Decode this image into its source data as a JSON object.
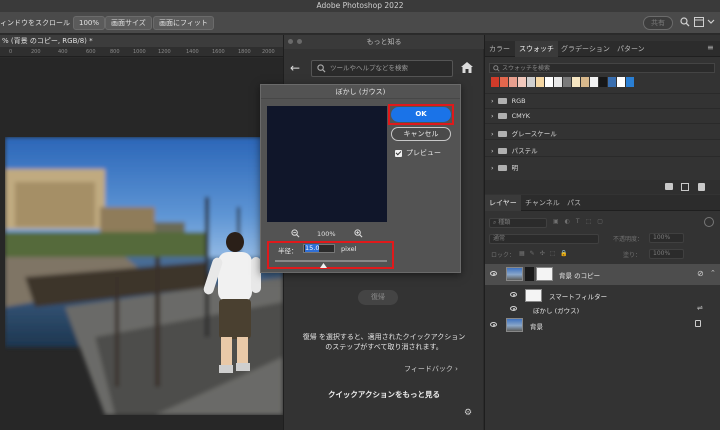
{
  "window": {
    "title": "Adobe Photoshop 2022"
  },
  "options_bar": {
    "scroll_all_label": "ィンドウをスクロール",
    "zoom_100_label": "100%",
    "screen_size_label": "画面サイズ",
    "fit_screen_label": "画面にフィット",
    "share_label": "共有"
  },
  "document": {
    "tab_title": "% (背景 のコピー, RGB/8) *",
    "ruler_ticks": [
      "0",
      "200",
      "400",
      "600",
      "800",
      "1000",
      "1200",
      "1400",
      "1600",
      "1800",
      "2000"
    ]
  },
  "discover_panel": {
    "title": "もっと知る",
    "search_placeholder": "ツールやヘルプなどを検索",
    "reset_label": "復帰",
    "description_line1": "復帰 を選択すると、適用されたクイックアクション",
    "description_line2": "のステップがすべて取り消されます。",
    "feedback_label": "フィードバック",
    "more_actions_label": "クイックアクションをもっと見る"
  },
  "blur_dialog": {
    "title": "ぼかし (ガウス)",
    "ok_label": "OK",
    "cancel_label": "キャンセル",
    "preview_label": "プレビュー",
    "zoom_level": "100%",
    "radius_label": "半径：",
    "radius_value": "15.0",
    "radius_unit": "pixel",
    "radius_slider_fraction": 0.43
  },
  "swatches_panel": {
    "tabs": [
      "カラー",
      "スウォッチ",
      "グラデーション",
      "パターン"
    ],
    "active_tab": "スウォッチ",
    "search_placeholder": "スウォッチを検索",
    "recent_colors": [
      "#d13b2a",
      "#e3674d",
      "#e9a08f",
      "#f2c9bd",
      "#cfcfcf",
      "#f5d7a3",
      "#ffffff",
      "#e8e8e8",
      "#7a7a7a",
      "#f6e6c2",
      "#d9b98c",
      "#f2f2f2",
      "#171717",
      "#3a6fb0",
      "#ffffff",
      "#2a7fd4"
    ],
    "folders": [
      "RGB",
      "CMYK",
      "グレースケール",
      "パステル",
      "明"
    ]
  },
  "layers_panel": {
    "tabs": [
      "レイヤー",
      "チャンネル",
      "パス"
    ],
    "active_tab": "レイヤー",
    "filter_kind": "種類",
    "blend_mode": "通常",
    "opacity_label": "不透明度：",
    "opacity_value": "100%",
    "lock_label": "ロック：",
    "fill_label": "塗り：",
    "fill_value": "100%",
    "layers": [
      {
        "name": "背景 のコピー",
        "type": "smart-object",
        "selected": true
      },
      {
        "name": "スマートフィルター",
        "type": "smart-filter-group"
      },
      {
        "name": "ぼかし (ガウス)",
        "type": "filter"
      },
      {
        "name": "背景",
        "type": "background",
        "locked": true
      }
    ]
  },
  "colors": {
    "accent_blue": "#1a73e8",
    "highlight_red": "#e0191b"
  }
}
